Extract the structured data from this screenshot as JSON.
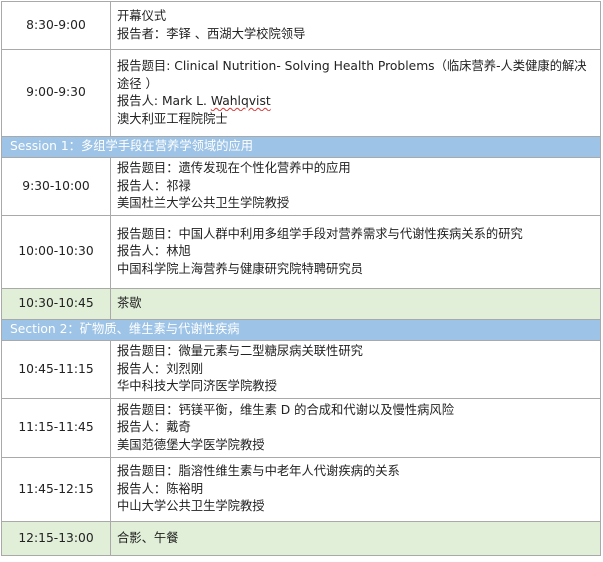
{
  "rows": [
    {
      "type": "item",
      "time": "8:30-9:00",
      "lines": [
        "开幕仪式",
        "报告者：李铎 、西湖大学校院领导"
      ]
    },
    {
      "type": "item",
      "time": "9:00-9:30",
      "title_line": "报告题目: Clinical Nutrition- Solving Health Problems（临床营养-人类健康的解决途径 ）",
      "speaker_prefix": "报告人: Mark L. ",
      "speaker_name": "Wahlqvist",
      "affiliation": "澳大利亚工程院院士"
    },
    {
      "type": "session",
      "label": "Session 1：多组学手段在营养学领域的应用"
    },
    {
      "type": "item",
      "time": "9:30-10:00",
      "lines": [
        "报告题目：遗传发现在个性化营养中的应用",
        "报告人：祁禄",
        "美国杜兰大学公共卫生学院教授"
      ]
    },
    {
      "type": "item",
      "time": "10:00-10:30",
      "lines": [
        "报告题目：中国人群中利用多组学手段对营养需求与代谢性疾病关系的研究",
        "报告人：林旭",
        "中国科学院上海营养与健康研究院特聘研究员"
      ]
    },
    {
      "type": "break",
      "time": "10:30-10:45",
      "lines": [
        "茶歇"
      ]
    },
    {
      "type": "session",
      "label": "Section 2：矿物质、维生素与代谢性疾病"
    },
    {
      "type": "item",
      "time": "10:45-11:15",
      "lines": [
        "报告题目：微量元素与二型糖尿病关联性研究",
        "报告人：刘烈刚",
        "华中科技大学同济医学院教授"
      ]
    },
    {
      "type": "item",
      "time": "11:15-11:45",
      "lines": [
        "报告题目：钙镁平衡，维生素 D 的合成和代谢以及慢性病风险",
        "报告人：戴奇",
        "美国范德堡大学医学院教授"
      ]
    },
    {
      "type": "item",
      "time": "11:45-12:15",
      "lines": [
        "报告题目：脂溶性维生素与中老年人代谢疾病的关系",
        "报告人：陈裕明",
        "中山大学公共卫生学院教授"
      ]
    },
    {
      "type": "break",
      "time": "12:15-13:00",
      "lines": [
        "合影、午餐"
      ]
    }
  ]
}
